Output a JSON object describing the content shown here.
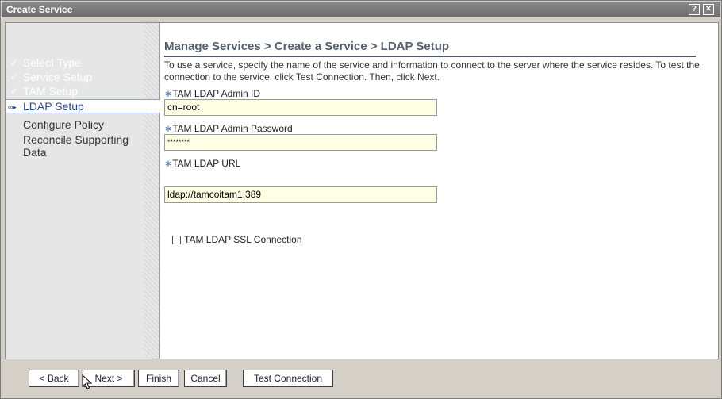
{
  "window": {
    "title": "Create Service",
    "help_label": "?",
    "close_label": "✕"
  },
  "sidebar": {
    "steps": [
      {
        "label": "Select Type",
        "status": "done",
        "mark": "✓"
      },
      {
        "label": "Service Setup",
        "status": "done",
        "mark": "✓"
      },
      {
        "label": "TAM Setup",
        "status": "done",
        "mark": "✓"
      },
      {
        "label": "LDAP Setup",
        "status": "current",
        "mark": "∞▸"
      },
      {
        "label": "Configure Policy",
        "status": "todo",
        "mark": ""
      },
      {
        "label": "Reconcile Supporting Data",
        "status": "todo",
        "mark": ""
      }
    ]
  },
  "main": {
    "breadcrumb": "Manage Services > Create a Service > LDAP Setup",
    "instructions": "To use a service, specify the name of the service and information to connect to the server where the service resides. To test the connection to the service, click Test Connection. Then, click Next.",
    "required_marker": "∗",
    "fields": [
      {
        "label": "TAM LDAP Admin ID",
        "value": "cn=root"
      },
      {
        "label": "TAM LDAP Admin Password",
        "value": "********"
      },
      {
        "label": "TAM LDAP URL",
        "value": "ldap://tamcoitam1:389"
      }
    ],
    "ssl_checkbox": {
      "label": "TAM LDAP SSL Connection",
      "checked": false
    }
  },
  "footer": {
    "back_label": "< Back",
    "next_label": "Next >",
    "finish_label": "Finish",
    "cancel_label": "Cancel",
    "test_label": "Test Connection"
  },
  "colors": {
    "titlebar": "#6c6c6c",
    "accent": "#2b4a8b",
    "field_bg": "#ffffe6"
  }
}
